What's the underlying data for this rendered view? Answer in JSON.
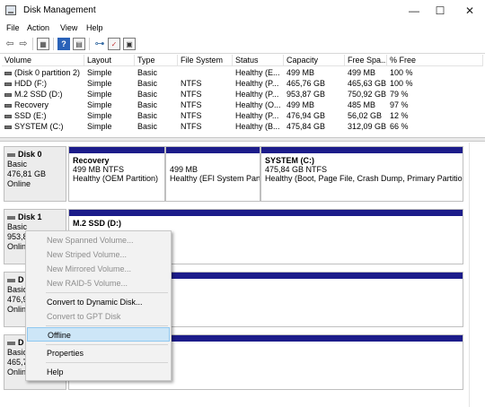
{
  "window": {
    "title": "Disk Management",
    "minimize": "—",
    "maximize": "☐",
    "close": "✕"
  },
  "menu": [
    "File",
    "Action",
    "View",
    "Help"
  ],
  "toolbar_icons": [
    "back-arrow-icon",
    "forward-arrow-icon",
    "console-tree-icon",
    "help-icon",
    "properties-icon",
    "disk-icon",
    "checklist-icon",
    "settings-icon"
  ],
  "columns": [
    "Volume",
    "Layout",
    "Type",
    "File System",
    "Status",
    "Capacity",
    "Free Spa...",
    "% Free"
  ],
  "volumes": [
    [
      "(Disk 0 partition 2)",
      "Simple",
      "Basic",
      "",
      "Healthy (E...",
      "499 MB",
      "499 MB",
      "100 %"
    ],
    [
      "HDD (F:)",
      "Simple",
      "Basic",
      "NTFS",
      "Healthy (P...",
      "465,76 GB",
      "465,63 GB",
      "100 %"
    ],
    [
      "M.2 SSD (D:)",
      "Simple",
      "Basic",
      "NTFS",
      "Healthy (P...",
      "953,87 GB",
      "750,92 GB",
      "79 %"
    ],
    [
      "Recovery",
      "Simple",
      "Basic",
      "NTFS",
      "Healthy (O...",
      "499 MB",
      "485 MB",
      "97 %"
    ],
    [
      "SSD (E:)",
      "Simple",
      "Basic",
      "NTFS",
      "Healthy (P...",
      "476,94 GB",
      "56,02 GB",
      "12 %"
    ],
    [
      "SYSTEM (C:)",
      "Simple",
      "Basic",
      "NTFS",
      "Healthy (B...",
      "475,84 GB",
      "312,09 GB",
      "66 %"
    ]
  ],
  "disks": {
    "d0": {
      "name": "Disk 0",
      "type": "Basic",
      "size": "476,81 GB",
      "status": "Online"
    },
    "d1": {
      "name": "Disk 1",
      "type": "Basic",
      "size": "953,8",
      "status": "Onlin"
    },
    "d2": {
      "name": "D",
      "type": "Basic",
      "size": "476,9",
      "status": "Onlin"
    },
    "d3": {
      "name": "D",
      "type": "Basic",
      "size": "465,7",
      "status": "Onlin"
    }
  },
  "partitions": {
    "p0": {
      "name": "Recovery",
      "size": "499 MB NTFS",
      "status": "Healthy (OEM Partition)"
    },
    "p1": {
      "name": "",
      "size": "499 MB",
      "status": "Healthy (EFI System Partition)"
    },
    "p2": {
      "name": "SYSTEM  (C:)",
      "size": "475,84 GB NTFS",
      "status": "Healthy (Boot, Page File, Crash Dump, Primary Partition)"
    },
    "p3": {
      "name": "M.2 SSD  (D:)",
      "size": "",
      "status": ""
    }
  },
  "context_menu": {
    "new_spanned": "New Spanned Volume...",
    "new_striped": "New Striped Volume...",
    "new_mirrored": "New Mirrored Volume...",
    "new_raid5": "New RAID-5 Volume...",
    "convert_dynamic": "Convert to Dynamic Disk...",
    "convert_gpt": "Convert to GPT Disk",
    "offline": "Offline",
    "properties": "Properties",
    "help": "Help"
  },
  "colors": {
    "partition_bar": "#1c1c8a",
    "highlight": "#cde6f7"
  }
}
